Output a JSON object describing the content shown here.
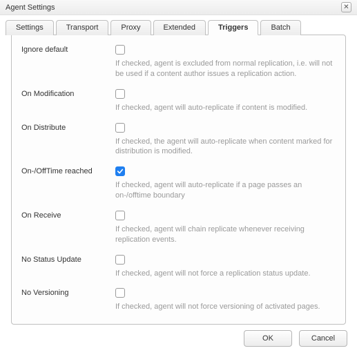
{
  "window": {
    "title": "Agent Settings",
    "close_glyph": "✕"
  },
  "tabs": [
    {
      "label": "Settings"
    },
    {
      "label": "Transport"
    },
    {
      "label": "Proxy"
    },
    {
      "label": "Extended"
    },
    {
      "label": "Triggers",
      "active": true
    },
    {
      "label": "Batch"
    }
  ],
  "triggers": [
    {
      "label": "Ignore default",
      "checked": false,
      "desc": "If checked, agent is excluded from normal replication, i.e. will not be used if a content author issues a replication action."
    },
    {
      "label": "On Modification",
      "checked": false,
      "desc": "If checked, agent will auto-replicate if content is modified."
    },
    {
      "label": "On Distribute",
      "checked": false,
      "desc": "If checked, the agent will auto-replicate when content marked for distribution is modified."
    },
    {
      "label": "On-/OffTime reached",
      "checked": true,
      "desc": "If checked, agent will auto-replicate if a page passes an on-/offtime boundary"
    },
    {
      "label": "On Receive",
      "checked": false,
      "desc": "If checked, agent will chain replicate whenever receiving replication events."
    },
    {
      "label": "No Status Update",
      "checked": false,
      "desc": "If checked, agent will not force a replication status update."
    },
    {
      "label": "No Versioning",
      "checked": false,
      "desc": "If checked, agent will not force versioning of activated pages."
    }
  ],
  "footer": {
    "ok": "OK",
    "cancel": "Cancel"
  }
}
